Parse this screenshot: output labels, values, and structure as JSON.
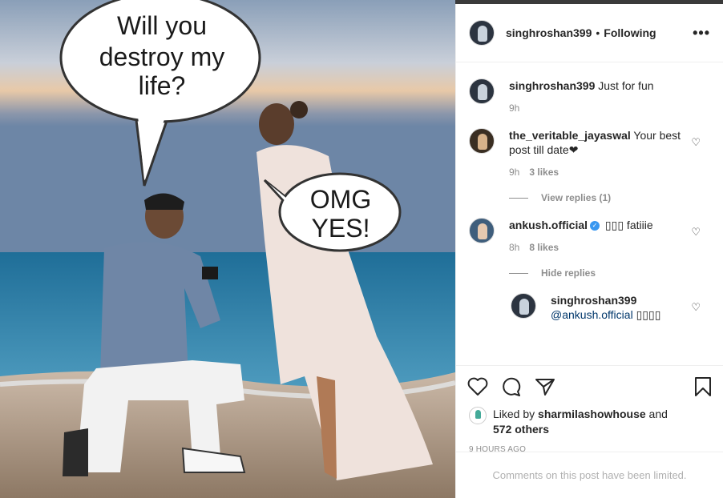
{
  "post": {
    "bubble_left": [
      "Will you",
      "destroy my",
      "life?"
    ],
    "bubble_right": [
      "OMG",
      "YES!"
    ]
  },
  "header": {
    "username": "singhroshan399",
    "separator": "•",
    "follow_status": "Following",
    "more_icon": "more-horizontal-icon"
  },
  "comments": [
    {
      "user": "singhroshan399",
      "text": "Just for fun",
      "time": "9h"
    },
    {
      "user": "the_veritable_jayaswal",
      "text": "Your best post till date❤",
      "time": "9h",
      "likes": "3 likes",
      "view_replies": "View replies (1)"
    },
    {
      "user": "ankush.official",
      "text": "▯▯▯ fatiiie",
      "time": "8h",
      "likes": "8 likes",
      "hide_replies": "Hide replies"
    }
  ],
  "reply": {
    "user": "singhroshan399",
    "mention": "@ankush.official",
    "text": "▯▯▯▯"
  },
  "actions": {
    "like_icon": "heart-icon",
    "comment_icon": "comment-icon",
    "share_icon": "share-icon",
    "save_icon": "bookmark-icon"
  },
  "likes": {
    "prefix": "Liked by",
    "user": "sharmilashowhouse",
    "and": "and",
    "others": "572 others"
  },
  "timestamp": "9 HOURS AGO",
  "comments_limited": "Comments on this post have been limited.",
  "colors": {
    "link": "#00376b",
    "muted": "#8e8e8e",
    "verified": "#3897f0"
  }
}
